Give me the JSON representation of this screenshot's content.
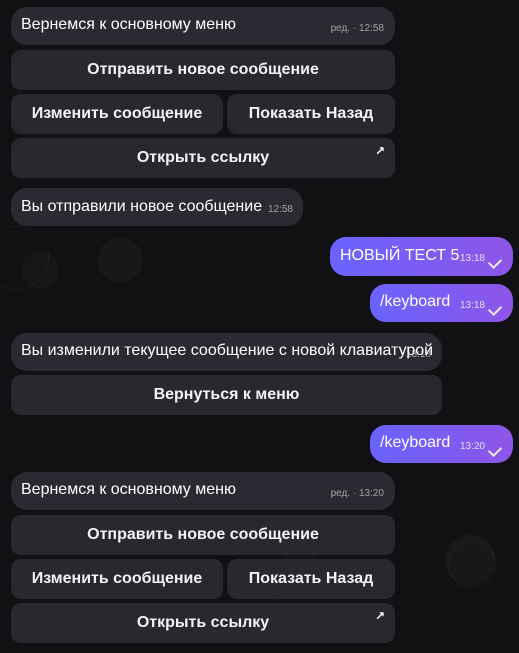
{
  "messages": [
    {
      "text": "Вернемся к основному меню",
      "meta": "ред. · 12:58"
    },
    {
      "text": "Вы отправили новое сообщение",
      "meta": "12:58"
    },
    {
      "text": "НОВЫЙ ТЕСТ 5",
      "meta": "13:18"
    },
    {
      "text": "/keyboard",
      "meta": "13:18"
    },
    {
      "text": "Вы изменили текущее сообщение с новой клавиатурой",
      "meta": "13:18"
    },
    {
      "text": "/keyboard",
      "meta": "13:20"
    },
    {
      "text": "Вернемся к основному меню",
      "meta": "ред. · 13:20"
    }
  ],
  "keyboard_top": {
    "send_new": "Отправить новое сообщение",
    "edit": "Изменить сообщение",
    "back": "Показать Назад",
    "open_link": "Открыть ссылку",
    "link_icon": "↗"
  },
  "keyboard_return": {
    "return": "Вернуться к меню"
  },
  "keyboard_bottom": {
    "send_new": "Отправить новое сообщение",
    "edit": "Изменить сообщение",
    "back": "Показать Назад",
    "open_link": "Открыть ссылку",
    "link_icon": "↗"
  },
  "colors": {
    "background": "#111113",
    "incoming": "#2a2a33",
    "outgoing_start": "#6a63ff",
    "outgoing_end": "#8e55e7"
  },
  "icons": {
    "read_receipt": "check-icon",
    "external_link": "external-link-icon"
  }
}
